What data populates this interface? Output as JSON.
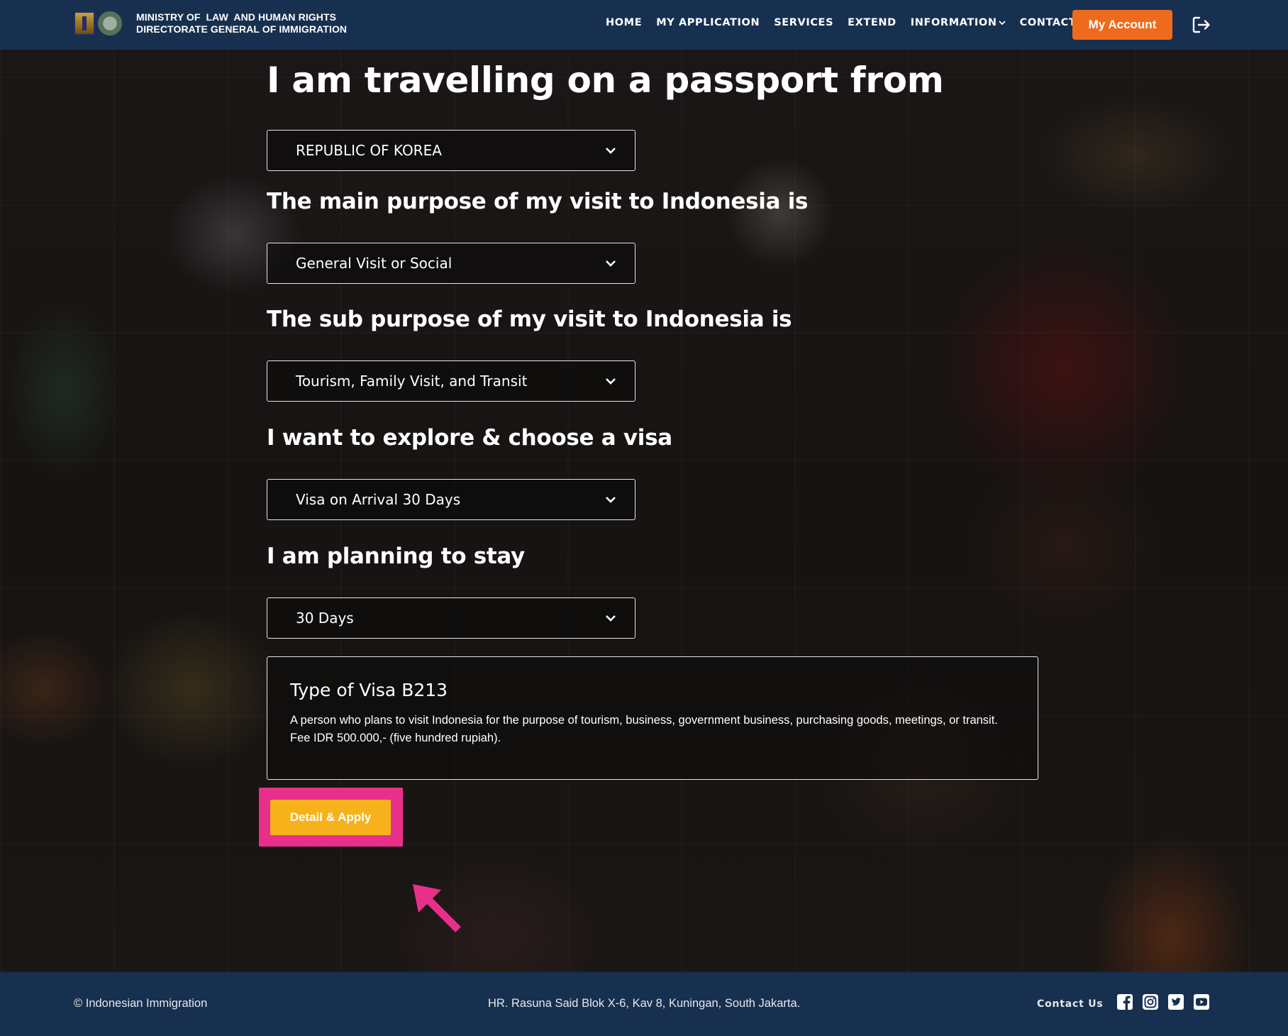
{
  "header": {
    "ministry_line1": "MINISTRY OF  LAW  AND HUMAN RIGHTS",
    "ministry_line2": "DIRECTORATE GENERAL OF IMMIGRATION",
    "nav": [
      {
        "label": "HOME"
      },
      {
        "label": "MY APPLICATION"
      },
      {
        "label": "SERVICES"
      },
      {
        "label": "EXTEND"
      },
      {
        "label": "INFORMATION"
      },
      {
        "label": "CONTACT US"
      }
    ],
    "account_label": "My Account",
    "accent_color": "#ee6b1e",
    "background_color": "#17304f"
  },
  "form": {
    "passport_question": "I am travelling on a passport from",
    "passport_value": "REPUBLIC OF KOREA",
    "purpose_question": "The main purpose of my visit to Indonesia is",
    "purpose_value": "General Visit or Social",
    "sub_purpose_question": "The sub purpose of my visit to Indonesia is",
    "sub_purpose_value": "Tourism, Family Visit, and Transit",
    "visa_question": "I want to explore & choose a visa",
    "visa_value": "Visa on Arrival 30 Days",
    "stay_question": "I am planning to stay",
    "stay_value": "30 Days"
  },
  "visa_info": {
    "title": "Type of Visa B213",
    "description": "A person who plans to visit Indonesia for the purpose of tourism, business, government business, purchasing goods, meetings, or transit. Fee IDR 500.000,- (five hundred rupiah)."
  },
  "apply_button": {
    "label": "Detail & Apply",
    "color": "#f7b21b",
    "highlight_color": "#e8308a"
  },
  "footer": {
    "copyright": "© Indonesian Immigration",
    "address": "HR. Rasuna Said Blok X-6, Kav 8, Kuningan, South Jakarta.",
    "contact_label": "Contact Us",
    "social": [
      "facebook-icon",
      "instagram-icon",
      "twitter-icon",
      "youtube-icon"
    ]
  }
}
